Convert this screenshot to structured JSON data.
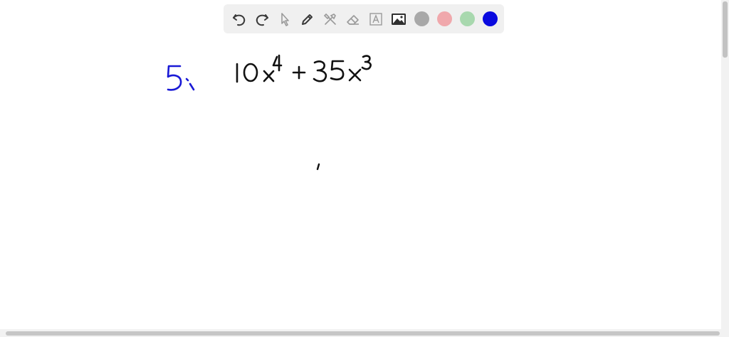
{
  "toolbar": {
    "tools": [
      {
        "name": "undo",
        "icon": "undo-icon"
      },
      {
        "name": "redo",
        "icon": "redo-icon"
      },
      {
        "name": "select",
        "icon": "pointer-icon"
      },
      {
        "name": "pen",
        "icon": "pencil-icon"
      },
      {
        "name": "tools",
        "icon": "tools-icon"
      },
      {
        "name": "eraser",
        "icon": "eraser-icon"
      },
      {
        "name": "text",
        "icon": "text-icon"
      },
      {
        "name": "image",
        "icon": "image-icon"
      }
    ],
    "colors": [
      {
        "name": "gray",
        "hex": "#a8a8a8"
      },
      {
        "name": "pink",
        "hex": "#f0a8ac"
      },
      {
        "name": "green",
        "hex": "#a8d8ae"
      },
      {
        "name": "blue",
        "hex": "#0a0adf"
      }
    ]
  },
  "whiteboard": {
    "problem_label": "5.",
    "expression": "10x^4 + 35x^3",
    "ink_colors": {
      "label": "#1a1ad6",
      "math": "#111111"
    }
  }
}
